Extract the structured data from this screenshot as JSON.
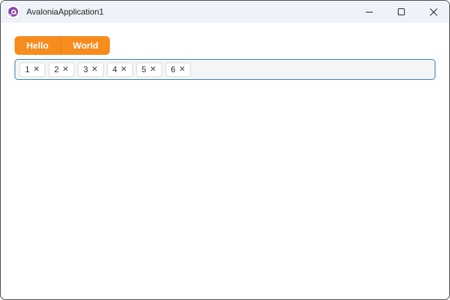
{
  "window": {
    "title": "AvaloniaApplication1",
    "titlebar_icon": "avalonia-logo",
    "controls": {
      "minimize": "minimize",
      "maximize": "maximize",
      "close": "close"
    }
  },
  "tabs": [
    {
      "label": "Hello"
    },
    {
      "label": "World"
    }
  ],
  "tags_input": {
    "items": [
      {
        "label": "1"
      },
      {
        "label": "2"
      },
      {
        "label": "3"
      },
      {
        "label": "4"
      },
      {
        "label": "5"
      },
      {
        "label": "6"
      }
    ],
    "remove_glyph": "✕"
  },
  "colors": {
    "accent_orange": "#f78c1e",
    "focus_border_blue": "#2e75ad",
    "titlebar_bg": "#eff3f9",
    "window_border": "#3e3e3e",
    "logo_purple": "#8b44ac"
  }
}
